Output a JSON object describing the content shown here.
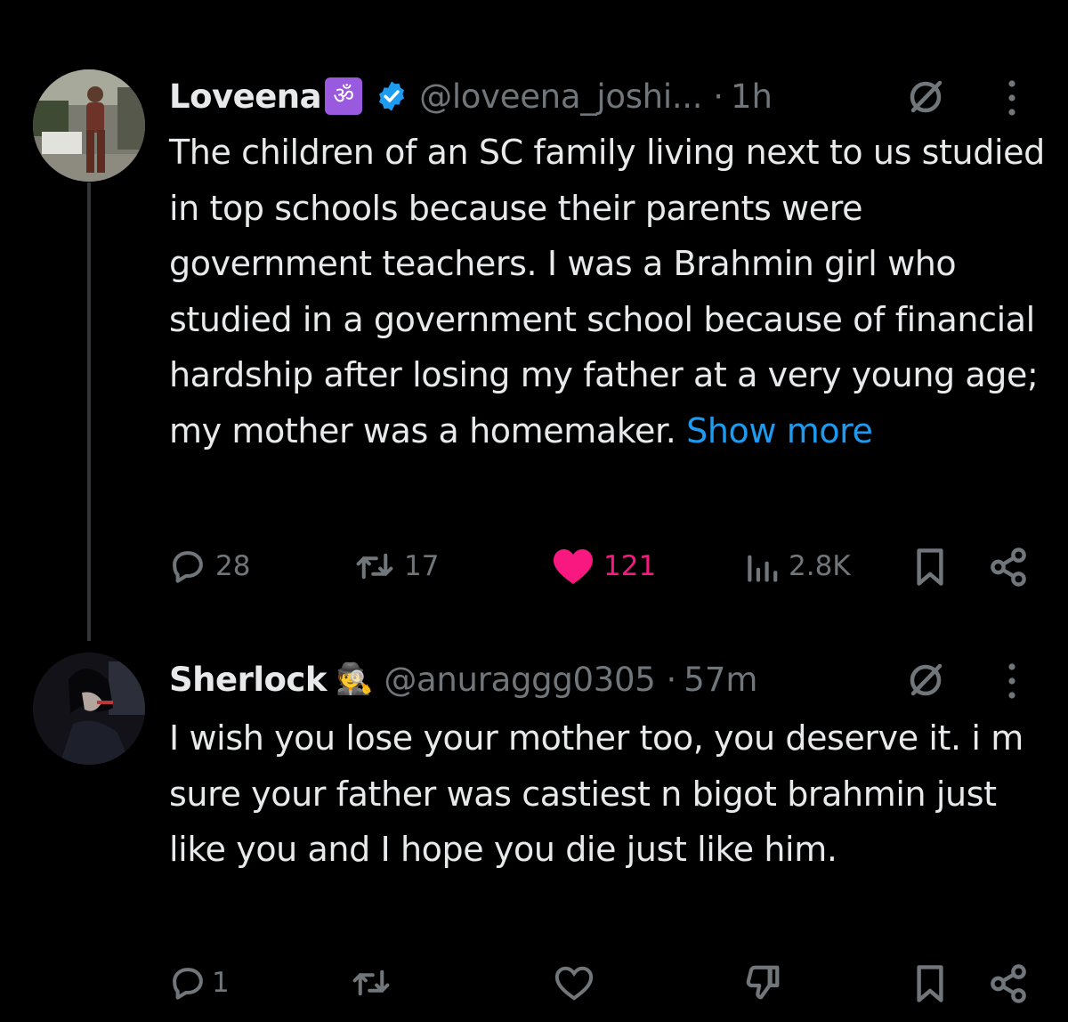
{
  "tweets": [
    {
      "author": {
        "name": "Loveena",
        "name_emoji": "ॐ",
        "verified": true,
        "handle": "@loveena_joshi...",
        "time": "1h"
      },
      "text": "The children of an SC family living next to us studied in top schools because their parents were government teachers. I was a Brahmin girl who studied in a government school because of financial hardship after losing my father at a very young age; my mother was a homemaker.",
      "show_more": "Show more",
      "metrics": {
        "replies": "28",
        "reposts": "17",
        "likes": "121",
        "views": "2.8K"
      }
    },
    {
      "author": {
        "name": "Sherlock",
        "name_emoji": "🕵️",
        "handle": "@anuraggg0305",
        "time": "57m"
      },
      "text": "I wish you lose your mother too, you deserve it. i m sure your father was castiest n bigot brahmin just like you and I hope you die just like him.",
      "metrics": {
        "replies": "1"
      }
    }
  ],
  "separator": "·",
  "icons": {
    "reply": "speech-bubble-icon",
    "repost": "retweet-arrows-icon",
    "like": "heart-icon",
    "views": "bar-chart-icon",
    "bookmark": "bookmark-icon",
    "share": "share-nodes-icon",
    "grok": "grok-slash-circle-icon",
    "more": "vertical-ellipsis-icon",
    "downvote": "thumbs-down-icon"
  },
  "colors": {
    "background": "#000000",
    "text": "#e7e9ea",
    "secondary": "#71767b",
    "link": "#1d9bf0",
    "like_active": "#f91880",
    "verified": "#1d9bf0",
    "thread_line": "#333639"
  }
}
